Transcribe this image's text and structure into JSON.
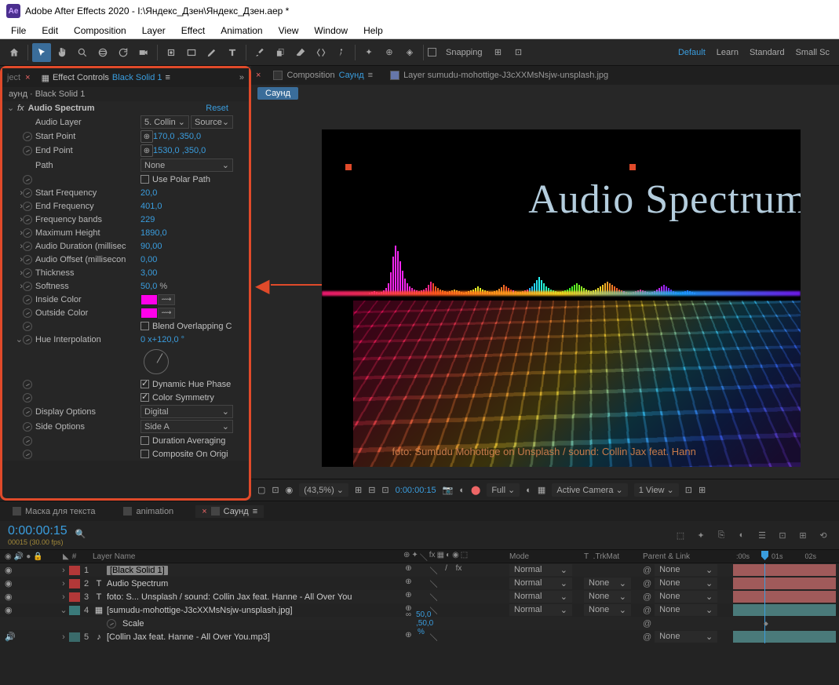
{
  "title": "Adobe After Effects 2020 - I:\\Яндекс_Дзен\\Яндекс_Дзен.аер *",
  "menu": [
    "File",
    "Edit",
    "Composition",
    "Layer",
    "Effect",
    "Animation",
    "View",
    "Window",
    "Help"
  ],
  "toolbar": {
    "snapping": "Snapping",
    "workspaces": [
      "Default",
      "Learn",
      "Standard",
      "Small Sc"
    ]
  },
  "effectControls": {
    "tabLabel": "Effect Controls",
    "tabTarget": "Black Solid 1",
    "breadcrumb": "аунд · Black Solid 1",
    "effectName": "Audio Spectrum",
    "reset": "Reset",
    "props": {
      "audioLayer": {
        "label": "Audio Layer",
        "value": "5. Collin",
        "source": "Source"
      },
      "startPoint": {
        "label": "Start Point",
        "value": "170,0 ,350,0"
      },
      "endPoint": {
        "label": "End Point",
        "value": "1530,0 ,350,0"
      },
      "path": {
        "label": "Path",
        "value": "None"
      },
      "usePolarPath": {
        "label": "Use Polar Path",
        "checked": false
      },
      "startFreq": {
        "label": "Start Frequency",
        "value": "20,0"
      },
      "endFreq": {
        "label": "End Frequency",
        "value": "401,0"
      },
      "freqBands": {
        "label": "Frequency bands",
        "value": "229"
      },
      "maxHeight": {
        "label": "Maximum Height",
        "value": "1890,0"
      },
      "audioDuration": {
        "label": "Audio Duration (millisec",
        "value": "90,00"
      },
      "audioOffset": {
        "label": "Audio Offset (millisecon",
        "value": "0,00"
      },
      "thickness": {
        "label": "Thickness",
        "value": "3,00"
      },
      "softness": {
        "label": "Softness",
        "value": "50,0",
        "unit": "%"
      },
      "insideColor": {
        "label": "Inside Color",
        "value": "#ff00ea"
      },
      "outsideColor": {
        "label": "Outside Color",
        "value": "#ff00ea"
      },
      "blendOverlap": {
        "label": "Blend Overlapping C",
        "checked": false
      },
      "hueInterp": {
        "label": "Hue Interpolation",
        "value": "0 x+120,0 °"
      },
      "dynHuePhase": {
        "label": "Dynamic Hue Phase",
        "checked": true
      },
      "colorSymmetry": {
        "label": "Color Symmetry",
        "checked": true
      },
      "displayOptions": {
        "label": "Display Options",
        "value": "Digital"
      },
      "sideOptions": {
        "label": "Side Options",
        "value": "Side A"
      },
      "durationAvg": {
        "label": "Duration Averaging",
        "checked": false
      },
      "compositeOrig": {
        "label": "Composite On Origi",
        "checked": false
      }
    }
  },
  "composition": {
    "tabLabel": "Composition",
    "tabTarget": "Саунд",
    "layerTab": "Layer sumudu-mohottige-J3cXXMsNsjw-unsplash.jpg",
    "chip": "Саунд",
    "bigText": "Audio Spectrum",
    "credit": "foto: Sumudu Mohottige on Unsplash / sound: Collin Jax feat. Hann"
  },
  "viewerBar": {
    "zoom": "(43,5%)",
    "timecode": "0:00:00:15",
    "quality": "Full",
    "camera": "Active Camera",
    "views": "1 View"
  },
  "panelTabs": [
    "Маска для текста",
    "animation",
    "Саунд"
  ],
  "timeline": {
    "time": "0:00:00:15",
    "fps": "00015 (30.00 fps)",
    "ruler": [
      ":00s",
      "01s",
      "02s"
    ],
    "cols": {
      "layerName": "Layer Name",
      "mode": "Mode",
      "t": "T",
      "trkMat": ".TrkMat",
      "parent": "Parent & Link"
    },
    "none": "None",
    "normal": "Normal",
    "rows": [
      {
        "num": "1",
        "color": "#b33838",
        "name": "[Black Solid 1]",
        "selected": true,
        "type": "solid",
        "hasMode": true,
        "hasTrk": false,
        "barColor": "#a05a5a"
      },
      {
        "num": "2",
        "color": "#b33838",
        "name": "Audio Spectrum",
        "type": "text",
        "hasMode": true,
        "hasTrk": true,
        "barColor": "#a05a5a"
      },
      {
        "num": "3",
        "color": "#b33838",
        "name": "foto: S... Unsplash / sound: Collin Jax feat. Hanne - All Over You",
        "type": "text",
        "hasMode": true,
        "hasTrk": true,
        "barColor": "#a05a5a"
      },
      {
        "num": "4",
        "color": "#3a7a7a",
        "name": "[sumudu-mohottige-J3cXXMsNsjw-unsplash.jpg]",
        "type": "image",
        "hasMode": true,
        "hasTrk": true,
        "barColor": "#4a7a7a",
        "expanded": true
      },
      {
        "scale": true,
        "label": "Scale",
        "value": "50,0 ,50,0 %"
      },
      {
        "num": "5",
        "color": "#3a6a6a",
        "name": "[Collin Jax feat. Hanne - All Over You.mp3]",
        "type": "audio",
        "hasMode": false,
        "hasTrk": false,
        "barColor": "#4a7a7a"
      }
    ],
    "linkIcon": "∞"
  }
}
